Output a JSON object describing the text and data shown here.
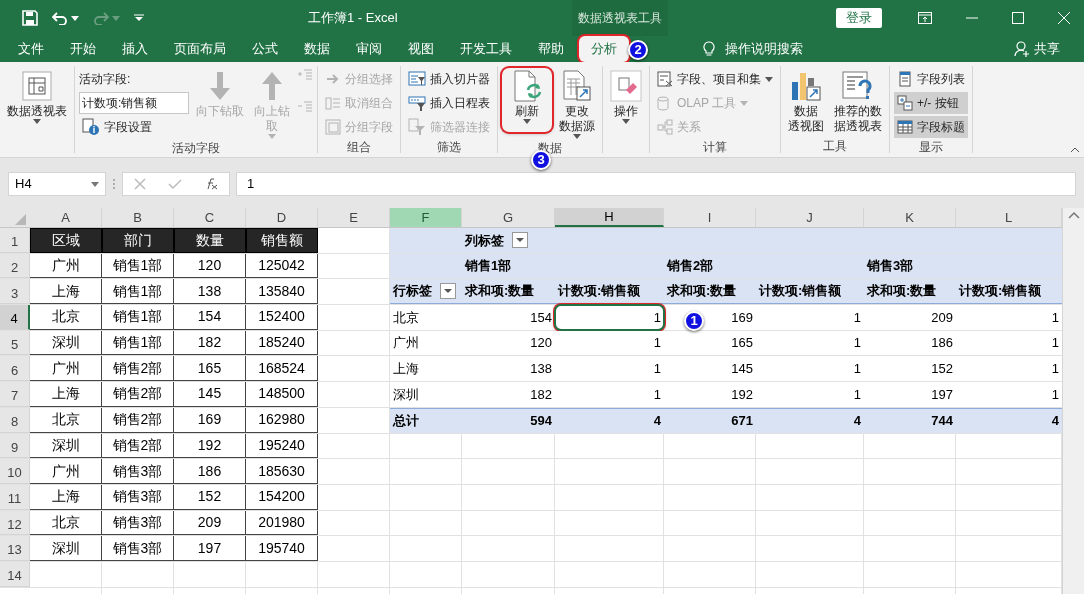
{
  "title_bar": {
    "title": "工作簿1 - Excel",
    "context_tab_group": "数据透视表工具",
    "sign_in": "登录"
  },
  "tabs": [
    {
      "label": "文件",
      "selected": false
    },
    {
      "label": "开始",
      "selected": false
    },
    {
      "label": "插入",
      "selected": false
    },
    {
      "label": "页面布局",
      "selected": false
    },
    {
      "label": "公式",
      "selected": false
    },
    {
      "label": "数据",
      "selected": false
    },
    {
      "label": "审阅",
      "selected": false
    },
    {
      "label": "视图",
      "selected": false
    },
    {
      "label": "开发工具",
      "selected": false
    },
    {
      "label": "帮助",
      "selected": false
    },
    {
      "label": "分析",
      "selected": true
    }
  ],
  "tell_me": "操作说明搜索",
  "share": "共享",
  "ribbon": {
    "groups": [
      {
        "items": [
          {
            "kind": "large",
            "label_lines": [
              "数据透视表"
            ],
            "caret": true,
            "disabled": false
          }
        ]
      },
      {
        "label": "活动字段",
        "items": [
          {
            "kind": "caption",
            "label": "活动字段:"
          },
          {
            "kind": "field",
            "value": "计数项:销售额"
          },
          {
            "kind": "small",
            "label": "字段设置",
            "disabled": false
          },
          {
            "kind": "large",
            "label_lines": [
              "向下钻取"
            ],
            "caret": false,
            "disabled": true
          },
          {
            "kind": "large",
            "label_lines": [
              "向上钻",
              "取"
            ],
            "caret": true,
            "disabled": true
          },
          {
            "kind": "mini",
            "disabled": true
          }
        ]
      },
      {
        "label": "组合",
        "items": [
          {
            "kind": "small",
            "label": "分组选择",
            "disabled": true
          },
          {
            "kind": "small",
            "label": "取消组合",
            "disabled": true
          },
          {
            "kind": "small",
            "label": "分组字段",
            "disabled": true
          }
        ]
      },
      {
        "label": "筛选",
        "items": [
          {
            "kind": "small",
            "label": "插入切片器",
            "disabled": false
          },
          {
            "kind": "small",
            "label": "插入日程表",
            "disabled": false
          },
          {
            "kind": "small",
            "label": "筛选器连接",
            "disabled": true
          }
        ]
      },
      {
        "label": "数据",
        "items": [
          {
            "kind": "large",
            "label_lines": [
              "刷新"
            ],
            "caret": true,
            "disabled": false
          },
          {
            "kind": "large",
            "label_lines": [
              "更改",
              "数据源"
            ],
            "caret": true,
            "disabled": false
          }
        ]
      },
      {
        "items": [
          {
            "kind": "large",
            "label_lines": [
              "操作"
            ],
            "caret": true,
            "disabled": false
          }
        ]
      },
      {
        "label": "计算",
        "items": [
          {
            "kind": "small",
            "label": "字段、项目和集",
            "caret": true,
            "disabled": false
          },
          {
            "kind": "small",
            "label": "OLAP 工具",
            "caret": true,
            "disabled": true
          },
          {
            "kind": "small",
            "label": "关系",
            "disabled": true
          }
        ]
      },
      {
        "label": "工具",
        "items": [
          {
            "kind": "large",
            "label_lines": [
              "数据",
              "透视图"
            ],
            "caret": false,
            "disabled": false
          },
          {
            "kind": "large",
            "label_lines": [
              "推荐的数",
              "据透视表"
            ],
            "caret": false,
            "disabled": false
          }
        ]
      },
      {
        "label": "显示",
        "items": [
          {
            "kind": "small",
            "label": "字段列表",
            "disabled": false,
            "selected": false
          },
          {
            "kind": "small",
            "label": "+/- 按钮",
            "disabled": false,
            "selected": true
          },
          {
            "kind": "small",
            "label": "字段标题",
            "disabled": false,
            "selected": true
          }
        ]
      }
    ]
  },
  "formula_bar": {
    "name_box": "H4",
    "formula": "1"
  },
  "sheet": {
    "column_headers": [
      {
        "label": "A",
        "selected": false,
        "highlighted": false
      },
      {
        "label": "B",
        "selected": false,
        "highlighted": false
      },
      {
        "label": "C",
        "selected": false,
        "highlighted": false
      },
      {
        "label": "D",
        "selected": false,
        "highlighted": false
      },
      {
        "label": "E",
        "selected": false,
        "highlighted": false
      },
      {
        "label": "F",
        "selected": false,
        "highlighted": true
      },
      {
        "label": "G",
        "selected": false,
        "highlighted": false
      },
      {
        "label": "H",
        "selected": true,
        "highlighted": false
      },
      {
        "label": "I",
        "selected": false,
        "highlighted": false
      },
      {
        "label": "J",
        "selected": false,
        "highlighted": false
      },
      {
        "label": "K",
        "selected": false,
        "highlighted": false
      },
      {
        "label": "L",
        "selected": false,
        "highlighted": false
      }
    ],
    "row_headers": [
      {
        "label": "1",
        "selected": false
      },
      {
        "label": "2",
        "selected": false
      },
      {
        "label": "3",
        "selected": false
      },
      {
        "label": "4",
        "selected": true
      },
      {
        "label": "5",
        "selected": false
      },
      {
        "label": "6",
        "selected": false
      },
      {
        "label": "7",
        "selected": false
      },
      {
        "label": "8",
        "selected": false
      },
      {
        "label": "9",
        "selected": false
      },
      {
        "label": "10",
        "selected": false
      },
      {
        "label": "11",
        "selected": false
      },
      {
        "label": "12",
        "selected": false
      },
      {
        "label": "13",
        "selected": false
      },
      {
        "label": "14",
        "selected": false
      }
    ],
    "source_table": {
      "columns": [
        "区域",
        "部门",
        "数量",
        "销售额"
      ],
      "rows": [
        [
          "广州",
          "销售1部",
          "120",
          "125042"
        ],
        [
          "上海",
          "销售1部",
          "138",
          "135840"
        ],
        [
          "北京",
          "销售1部",
          "154",
          "152400"
        ],
        [
          "深圳",
          "销售1部",
          "182",
          "185240"
        ],
        [
          "广州",
          "销售2部",
          "165",
          "168524"
        ],
        [
          "上海",
          "销售2部",
          "145",
          "148500"
        ],
        [
          "北京",
          "销售2部",
          "169",
          "162980"
        ],
        [
          "深圳",
          "销售2部",
          "192",
          "195240"
        ],
        [
          "广州",
          "销售3部",
          "186",
          "185630"
        ],
        [
          "上海",
          "销售3部",
          "152",
          "154200"
        ],
        [
          "北京",
          "销售3部",
          "209",
          "201980"
        ],
        [
          "深圳",
          "销售3部",
          "197",
          "195740"
        ]
      ]
    },
    "pivot": {
      "column_labels": "列标签",
      "row_labels": "行标签",
      "departments": [
        "销售1部",
        "销售2部",
        "销售3部"
      ],
      "value_headers": [
        "求和项:数量",
        "计数项:销售额",
        "求和项:数量",
        "计数项:销售额",
        "求和项:数量",
        "计数项:销售额"
      ],
      "rows": [
        {
          "label": "北京",
          "values": [
            "154",
            "1",
            "169",
            "1",
            "209",
            "1"
          ]
        },
        {
          "label": "广州",
          "values": [
            "120",
            "1",
            "165",
            "1",
            "186",
            "1"
          ]
        },
        {
          "label": "上海",
          "values": [
            "138",
            "1",
            "145",
            "1",
            "152",
            "1"
          ]
        },
        {
          "label": "深圳",
          "values": [
            "182",
            "1",
            "192",
            "1",
            "197",
            "1"
          ]
        }
      ],
      "total": {
        "label": "总计",
        "values": [
          "594",
          "4",
          "671",
          "4",
          "744",
          "4"
        ]
      }
    }
  },
  "step_markers": [
    "1",
    "2",
    "3"
  ]
}
